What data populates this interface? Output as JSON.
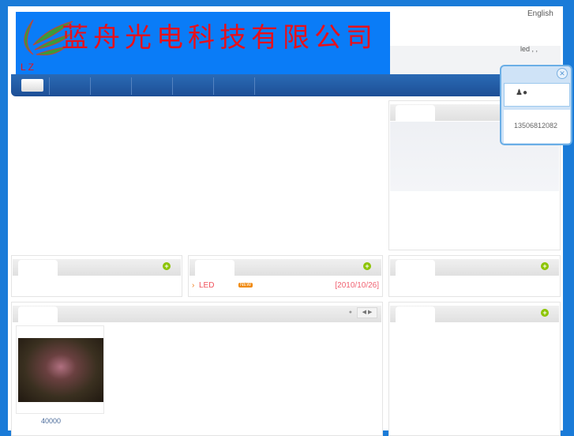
{
  "header": {
    "company_name": "蓝舟光电科技有限公司",
    "logo_letters": "L Z",
    "language_link": "English",
    "top_text": "led  , ,"
  },
  "contact_popup": {
    "phone": "13506812082",
    "qq_icons": "qq-icon"
  },
  "news": {
    "items": [
      {
        "title": "LED",
        "badge": "NEW",
        "date": "[2010/10/26]"
      }
    ]
  },
  "products": {
    "items": [
      {
        "caption": "40000"
      }
    ]
  },
  "colors": {
    "background": "#1a7bd8",
    "logo_bg": "#0a7cf7",
    "nav": "#1d4f96",
    "accent_red": "#e8101a"
  }
}
